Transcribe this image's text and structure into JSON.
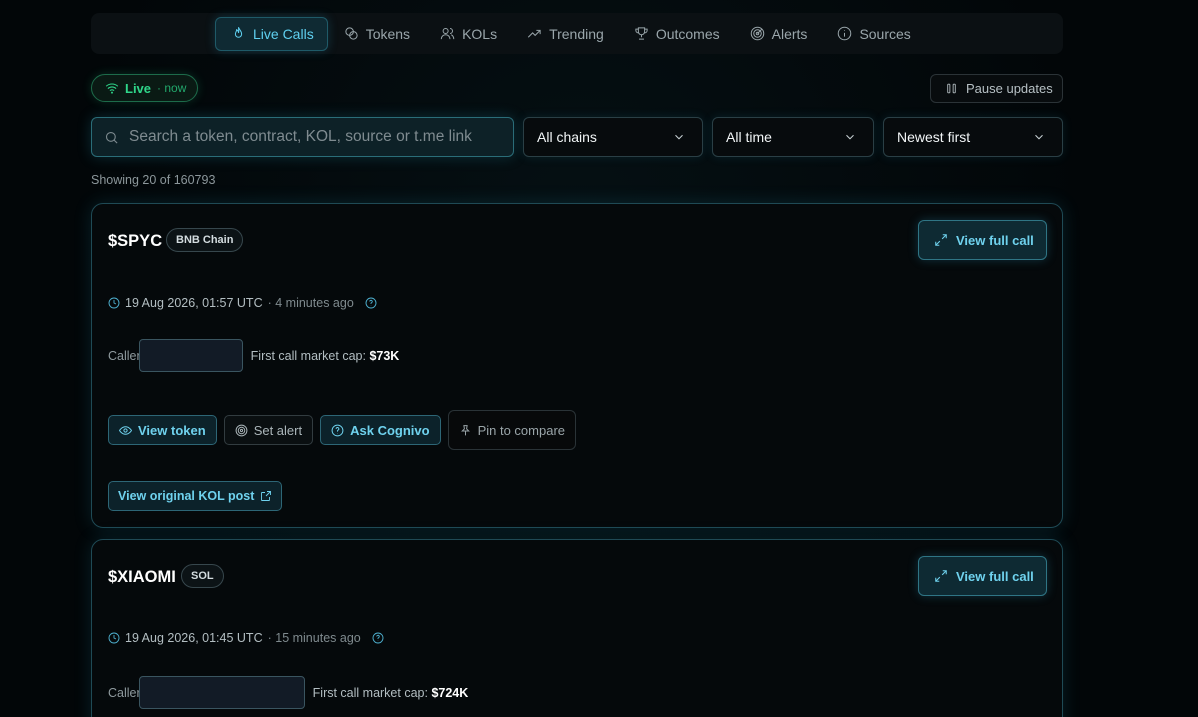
{
  "nav": {
    "items": [
      {
        "label": "Live Calls",
        "icon": "flame-icon",
        "active": true
      },
      {
        "label": "Tokens",
        "icon": "coins-icon"
      },
      {
        "label": "KOLs",
        "icon": "users-icon"
      },
      {
        "label": "Trending",
        "icon": "trending-up-icon"
      },
      {
        "label": "Outcomes",
        "icon": "trophy-icon"
      },
      {
        "label": "Alerts",
        "icon": "radar-icon"
      },
      {
        "label": "Sources",
        "icon": "info-icon"
      }
    ]
  },
  "status": {
    "live_label": "Live",
    "live_suffix": "· now",
    "pause_label": "Pause updates"
  },
  "filters": {
    "search_placeholder": "Search a token, contract, KOL, source or t.me link",
    "chain": "All chains",
    "time": "All time",
    "sort": "Newest first"
  },
  "results": {
    "showing": "Showing 20 of 160793"
  },
  "calls": [
    {
      "ticker": "$SPYC",
      "chain": "BNB Chain",
      "timestamp": "19 Aug 2026, 01:57 UTC",
      "ago": "· 4 minutes ago",
      "caller_label": "Caller",
      "mcap_label": "First call market cap:",
      "mcap_value": "$73K",
      "view_full": "View full call",
      "actions": {
        "view_token": "View token",
        "set_alert": "Set alert",
        "ask": "Ask Cognivo",
        "pin": "Pin to compare"
      },
      "original_post": "View original KOL post"
    },
    {
      "ticker": "$XIAOMI",
      "chain": "SOL",
      "timestamp": "19 Aug 2026, 01:45 UTC",
      "ago": "· 15 minutes ago",
      "caller_label": "Caller",
      "mcap_label": "First call market cap:",
      "mcap_value": "$724K",
      "view_full": "View full call"
    }
  ],
  "colors": {
    "accent": "#5fd0f0",
    "live_green": "#2fd68a",
    "background": "#020608"
  }
}
